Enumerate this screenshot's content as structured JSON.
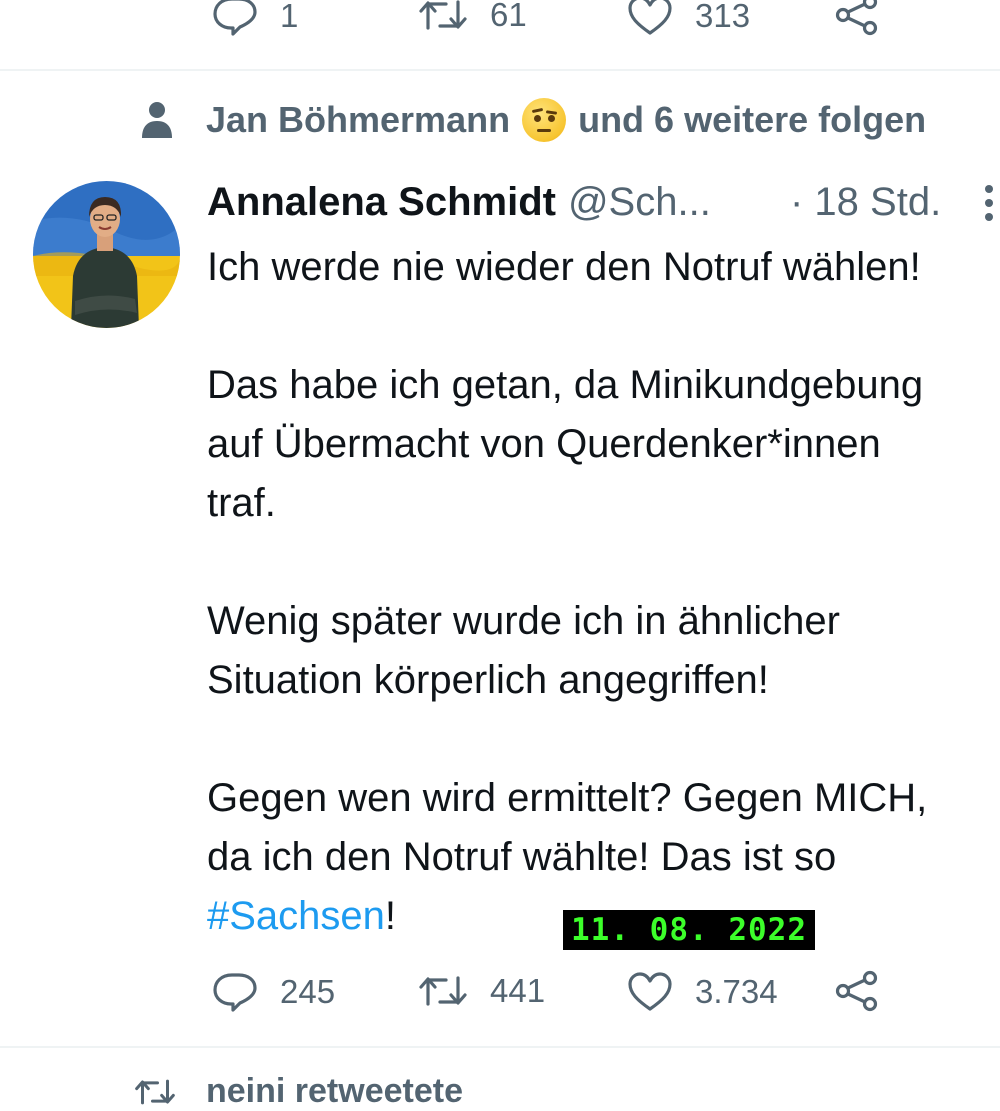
{
  "prev_tweet": {
    "replies": "1",
    "retweets": "61",
    "likes": "313"
  },
  "social_context": {
    "text_before": "Jan Böhmermann",
    "text_after": "und 6 weitere folgen",
    "emoji": "face-with-raised-eyebrow"
  },
  "tweet": {
    "author_name": "Annalena Schmidt",
    "author_handle": "@Sch...",
    "time": "· 18 Std.",
    "lines": [
      "Ich werde nie wieder den Notruf wählen!",
      "",
      "Das habe ich getan, da Minikundgebung",
      "auf Übermacht von Querdenker*innen",
      "traf.",
      "",
      "Wenig später wurde ich in ähnlicher",
      "Situation körperlich angegriffen!",
      "",
      "Gegen wen wird ermittelt? Gegen MICH,",
      "da ich den Notruf wählte! Das ist so"
    ],
    "hashtag": "#Sachsen",
    "hashtag_suffix": "!",
    "replies": "245",
    "retweets": "441",
    "likes": "3.734"
  },
  "date_stamp": "11. 08. 2022",
  "next_context": {
    "text": "neini retweetete"
  },
  "colors": {
    "text": "#0f1419",
    "secondary": "#536471",
    "link": "#1d9bf0",
    "divider": "#eff3f4",
    "stamp_text": "#3cff2a"
  }
}
